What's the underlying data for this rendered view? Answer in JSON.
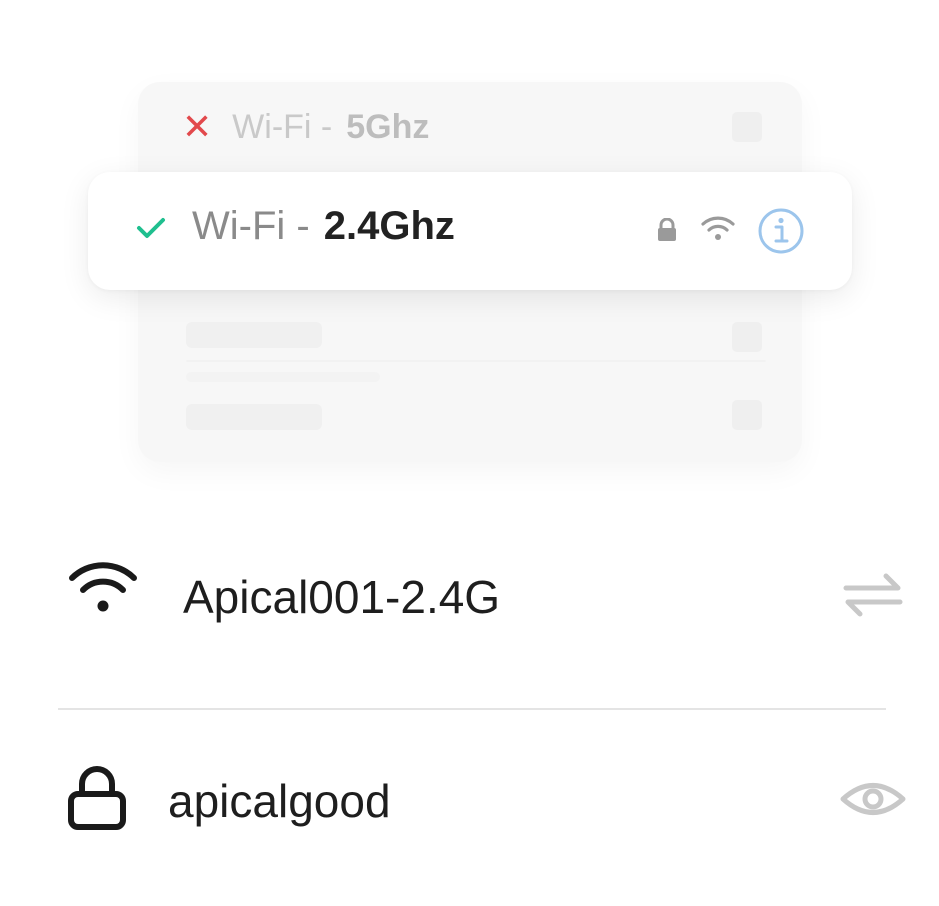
{
  "illustration": {
    "network_5g": {
      "prefix": "Wi-Fi -",
      "band": "5Ghz",
      "status_icon": "x-mark-icon",
      "status_color": "#e2494c"
    },
    "network_24g": {
      "prefix": "Wi-Fi -",
      "band": "2.4Ghz",
      "status_icon": "check-icon",
      "status_color": "#1fbf8f",
      "icons": [
        "lock-icon",
        "wifi-icon",
        "info-icon"
      ]
    }
  },
  "form": {
    "ssid": {
      "icon": "wifi-icon",
      "value": "Apical001-2.4G",
      "action_icon": "swap-icon"
    },
    "password": {
      "icon": "lock-icon",
      "value": "apicalgood",
      "action_icon": "eye-icon"
    }
  },
  "colors": {
    "accent_info": "#9cc5ec",
    "text_primary": "#1e1e1e",
    "muted_icon": "#c8c8c8"
  }
}
